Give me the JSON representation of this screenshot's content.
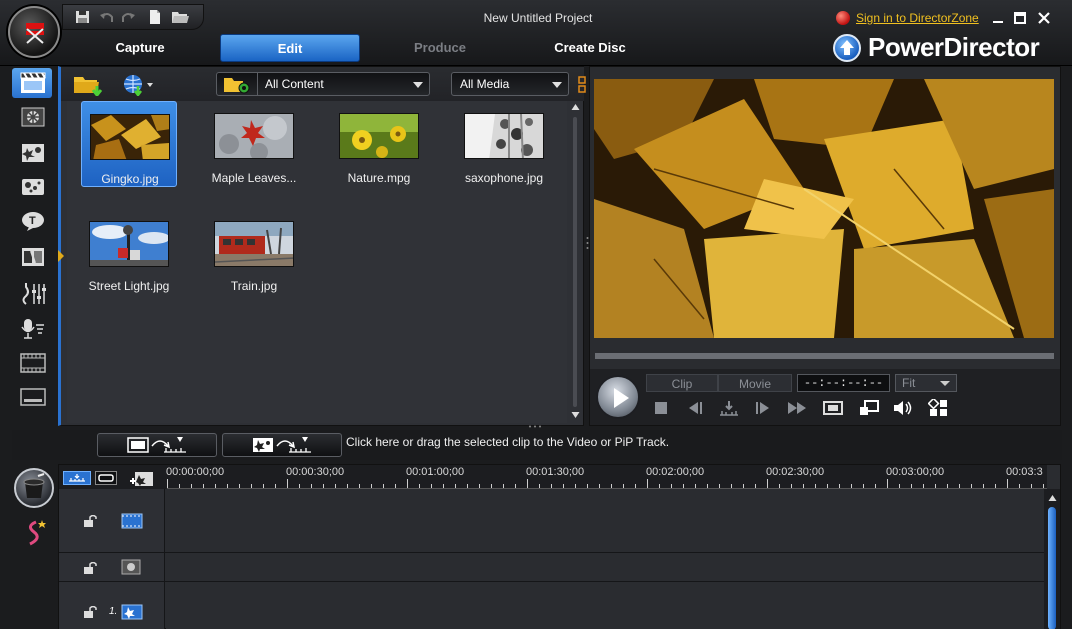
{
  "window": {
    "title": "New Untitled Project",
    "sign_in": "Sign in to DirectorZone",
    "controls": [
      "minimize",
      "maximize",
      "close"
    ]
  },
  "brand": "PowerDirector",
  "modes": [
    {
      "label": "Capture",
      "state": "normal"
    },
    {
      "label": "Edit",
      "state": "active"
    },
    {
      "label": "Produce",
      "state": "disabled"
    },
    {
      "label": "Create Disc",
      "state": "normal"
    }
  ],
  "quick_access": [
    "save-icon",
    "undo-icon",
    "redo-icon",
    "new-project-icon",
    "open-project-icon"
  ],
  "rooms": [
    {
      "name": "media-room-icon",
      "active": true
    },
    {
      "name": "effect-room-icon"
    },
    {
      "name": "pip-objects-room-icon"
    },
    {
      "name": "particle-room-icon"
    },
    {
      "name": "title-room-icon"
    },
    {
      "name": "transition-room-icon"
    },
    {
      "name": "audio-mixing-room-icon"
    },
    {
      "name": "voice-over-room-icon"
    },
    {
      "name": "chapter-room-icon"
    },
    {
      "name": "subtitle-room-icon"
    }
  ],
  "library": {
    "filter": "All Content",
    "media_type": "All Media",
    "items": [
      {
        "label": "Gingko.jpg",
        "selected": true,
        "thumb": "gingko"
      },
      {
        "label": "Maple Leaves...",
        "thumb": "maple"
      },
      {
        "label": "Nature.mpg",
        "thumb": "nature"
      },
      {
        "label": "saxophone.jpg",
        "thumb": "sax"
      },
      {
        "label": "Street Light.jpg",
        "thumb": "street"
      },
      {
        "label": "Train.jpg",
        "thumb": "train"
      }
    ]
  },
  "preview": {
    "mode_clip": "Clip",
    "mode_movie": "Movie",
    "timecode": "--:--:--:--",
    "zoom": "Fit"
  },
  "timeline": {
    "drop_hint": "Click here or drag the selected clip to the Video or PiP Track.",
    "ticks": [
      "00:00:00;00",
      "00:00:30;00",
      "00:01:00;00",
      "00:01:30;00",
      "00:02:00;00",
      "00:02:30;00",
      "00:03:00;00",
      "00:03:3"
    ],
    "tracks": [
      {
        "type": "video",
        "label": ""
      },
      {
        "type": "effect",
        "label": ""
      },
      {
        "type": "pip",
        "label": "1."
      }
    ]
  },
  "colors": {
    "accent": "#2a72d0",
    "signin": "#f0c020"
  }
}
